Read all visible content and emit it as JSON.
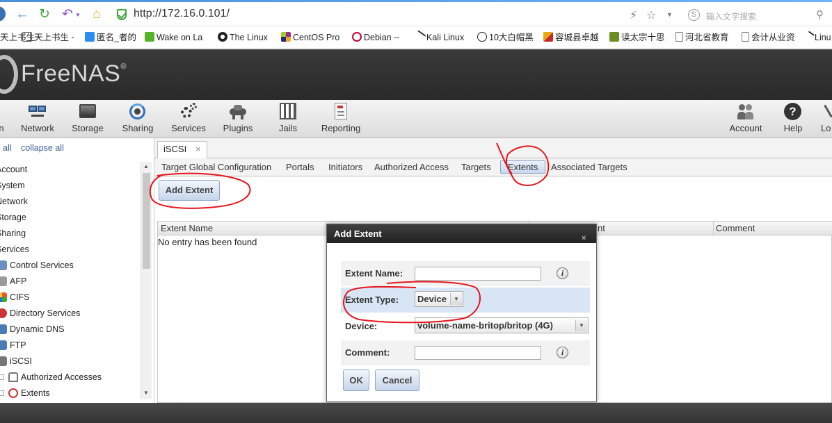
{
  "browser": {
    "url": "http://172.16.0.101/",
    "search_placeholder": "输入文字搜索",
    "bookmarks": [
      "天上书生 -",
      "匿名_者的",
      "Wake on La",
      "The Linux",
      "CentOS Pro",
      "Debian --",
      "Kali Linux",
      "10大白帽黑",
      "容城县卓越",
      "读太宗十思",
      "河北省教育",
      "会计从业资",
      "Linu"
    ]
  },
  "app": {
    "logo": "FreeNAS",
    "logo_mark": "®",
    "topnav": [
      {
        "label": "n"
      },
      {
        "label": "Network"
      },
      {
        "label": "Storage"
      },
      {
        "label": "Sharing"
      },
      {
        "label": "Services"
      },
      {
        "label": "Plugins"
      },
      {
        "label": "Jails"
      },
      {
        "label": "Reporting"
      },
      {
        "label": "Account"
      },
      {
        "label": "Help"
      },
      {
        "label": "Lo"
      }
    ]
  },
  "sidebar": {
    "expand_all": "all",
    "collapse_all": "collapse all",
    "items": [
      {
        "label": "Account"
      },
      {
        "label": "System"
      },
      {
        "label": "Network"
      },
      {
        "label": "Storage"
      },
      {
        "label": "Sharing"
      },
      {
        "label": "Services"
      },
      {
        "label": "Control Services"
      },
      {
        "label": "AFP"
      },
      {
        "label": "CIFS"
      },
      {
        "label": "Directory Services"
      },
      {
        "label": "Dynamic DNS"
      },
      {
        "label": "FTP"
      },
      {
        "label": "iSCSI"
      },
      {
        "label": "Authorized Accesses"
      },
      {
        "label": "Extents"
      }
    ]
  },
  "main": {
    "tab": {
      "label": "iSCSI",
      "close": "×"
    },
    "subtabs": [
      {
        "label": "Target Global Configuration"
      },
      {
        "label": "Portals"
      },
      {
        "label": "Initiators"
      },
      {
        "label": "Authorized Access"
      },
      {
        "label": "Targets"
      },
      {
        "label": "Extents"
      },
      {
        "label": "Associated Targets"
      }
    ],
    "add_button": "Add Extent",
    "grid": {
      "columns": [
        "Extent Name",
        "nt",
        "Comment"
      ],
      "empty": "No entry has been found"
    }
  },
  "modal": {
    "title": "Add Extent",
    "close": "×",
    "fields": {
      "name_label": "Extent Name:",
      "name_value": "",
      "type_label": "Extent Type:",
      "type_value": "Device",
      "device_label": "Device:",
      "device_value": "volume-name-britop/britop (4G)",
      "comment_label": "Comment:",
      "comment_value": ""
    },
    "info": "i",
    "ok": "OK",
    "cancel": "Cancel"
  },
  "colors": {
    "annotation": "#e8141b",
    "accent": "#8da5c6",
    "header": "#2e2e2e"
  }
}
